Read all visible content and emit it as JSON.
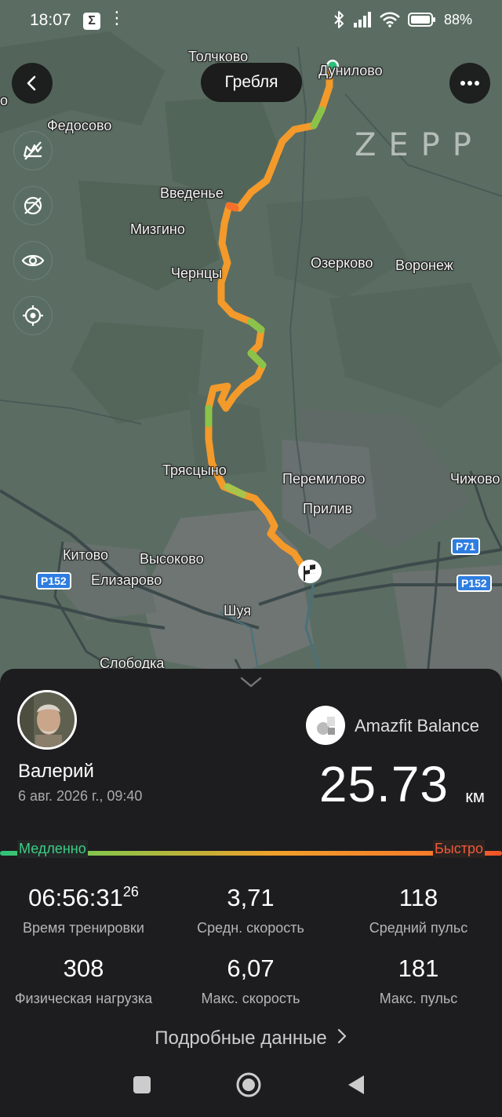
{
  "status_bar": {
    "time": "18:07",
    "sigma_icon": "Σ",
    "more_dots": "⋮",
    "battery_percent": "88%",
    "icons": [
      "bluetooth-icon",
      "cell-signal-icon",
      "wifi-icon",
      "battery-icon"
    ]
  },
  "map": {
    "activity_type": "Гребля",
    "watermark": "ZEPP",
    "places": {
      "tolchkovo": "Толчково",
      "dunilovo": "Дунилово",
      "fedosovo": "Федосово",
      "vvedenye": "Введенье",
      "mizgino": "Мизгино",
      "chernцy": "Чернцы",
      "ozerkovo": "Озерково",
      "voronezh": "Воронеж",
      "tryastsyno": "Трясцыно",
      "peremilovo": "Перемилово",
      "priliv": "Прилив",
      "chizhovo": "Чижово",
      "kitovo": "Китово",
      "vysokovo": "Высоково",
      "elizarovo": "Елизарово",
      "shuya": "Шуя",
      "sloboдka": "Слободка"
    },
    "road_signs": {
      "p71": "Р71",
      "p152_left": "Р152",
      "p152_right": "Р152"
    },
    "route_colors": {
      "slow": "#2cc37a",
      "mid": "#f0a02a",
      "fast": "#f57c2a"
    }
  },
  "summary": {
    "user_name": "Валерий",
    "date": "6 авг. 2026 г., 09:40",
    "device_name": "Amazfit Balance",
    "distance_value": "25.73",
    "distance_unit": "км",
    "speed_scale": {
      "slow": "Медленно",
      "fast": "Быстро"
    },
    "stats": [
      {
        "value": "06:56:31",
        "sup": "26",
        "label": "Время тренировки"
      },
      {
        "value": "3,71",
        "sup": "",
        "label": "Средн. скорость"
      },
      {
        "value": "118",
        "sup": "",
        "label": "Средний пульс"
      },
      {
        "value": "308",
        "sup": "",
        "label": "Физическая нагрузка"
      },
      {
        "value": "6,07",
        "sup": "",
        "label": "Макс. скорость"
      },
      {
        "value": "181",
        "sup": "",
        "label": "Макс. пульс"
      }
    ],
    "details_link": "Подробные данные"
  },
  "navbar": {
    "icons": [
      "recents-square-icon",
      "home-circle-icon",
      "back-triangle-icon"
    ]
  }
}
